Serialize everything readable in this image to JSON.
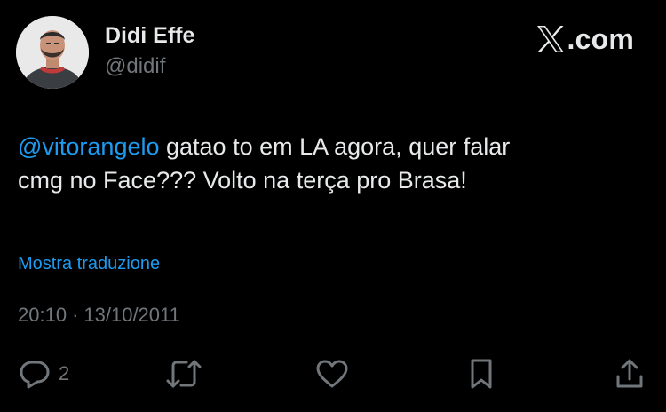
{
  "author": {
    "display_name": "Didi Effe",
    "handle": "@didif",
    "avatar_icon": "person-avatar"
  },
  "brand": {
    "text": ".com",
    "logo_icon": "x-logo-icon"
  },
  "tweet": {
    "mention": "@vitorangelo",
    "text_part1": " gatao to em LA agora, quer falar",
    "text_part2": "cmg no Face??? Volto na terça pro Brasa!",
    "translate_link": "Mostra traduzione",
    "time": "20:10",
    "separator": "·",
    "date": "13/10/2011"
  },
  "actions": {
    "reply": {
      "icon": "reply-icon",
      "count": "2"
    },
    "retweet": {
      "icon": "retweet-icon"
    },
    "like": {
      "icon": "heart-icon"
    },
    "bookmark": {
      "icon": "bookmark-icon"
    },
    "share": {
      "icon": "share-icon"
    }
  },
  "colors": {
    "background": "#000000",
    "text_primary": "#e7e9ea",
    "text_secondary": "#71767b",
    "accent": "#1d9bf0"
  }
}
